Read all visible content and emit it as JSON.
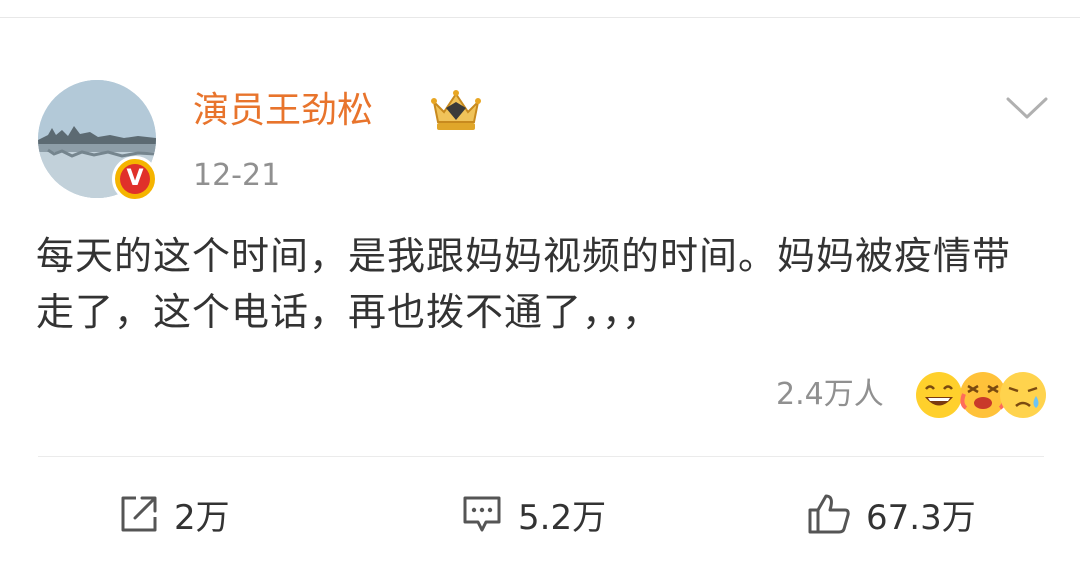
{
  "post": {
    "username": "演员王劲松",
    "date": "12-21",
    "content": "每天的这个时间，是我跟妈妈视频的时间。妈妈被疫情带走了，这个电话，再也拨不通了，，，",
    "reactions": {
      "count": "2.4万人",
      "emojis": [
        "laughing-emoji-icon",
        "crying-emoji-icon",
        "sad-emoji-icon"
      ]
    }
  },
  "actions": {
    "repost": {
      "icon": "share-icon",
      "count": "2万"
    },
    "comment": {
      "icon": "comment-icon",
      "count": "5.2万"
    },
    "like": {
      "icon": "thumbs-up-icon",
      "count": "67.3万"
    }
  },
  "colors": {
    "username": "#e8742c",
    "text": "#333333",
    "secondary": "#909090",
    "verified_badge": "#e0302a"
  }
}
